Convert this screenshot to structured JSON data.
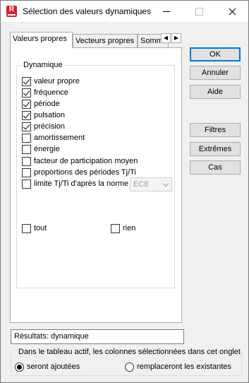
{
  "window": {
    "title": "Sélection des valeurs dynamiques",
    "app_icon_letter": "R"
  },
  "tabs": [
    {
      "label": "Valeurs propres",
      "active": true
    },
    {
      "label": "Vecteurs propres",
      "active": false
    },
    {
      "label": "Somm",
      "active": false
    }
  ],
  "group": {
    "legend": "Dynamique",
    "items": [
      {
        "label": "valeur propre",
        "checked": true
      },
      {
        "label": "fréquence",
        "checked": true
      },
      {
        "label": "période",
        "checked": true
      },
      {
        "label": "pulsation",
        "checked": true
      },
      {
        "label": "précision",
        "checked": true
      },
      {
        "label": "amortissement",
        "checked": false
      },
      {
        "label": "énergie",
        "checked": false
      },
      {
        "label": "facteur de participation moyen",
        "checked": false
      },
      {
        "label": "proportions des périodes Tj/Ti",
        "checked": false
      },
      {
        "label": "limite Tj/Ti d'après la norme",
        "checked": false
      }
    ],
    "norm_select": {
      "value": "EC8"
    },
    "all_label": "tout",
    "none_label": "rien"
  },
  "buttons": {
    "ok": "OK",
    "cancel": "Annuler",
    "help": "Aide",
    "filters": "Filtres",
    "extremes": "Extrêmes",
    "cases": "Cas"
  },
  "result": "Résultats: dynamique",
  "bottom": {
    "legend": "Dans le tableau actif, les colonnes sélectionnées dans cet onglet",
    "options": [
      {
        "label": "seront ajoutées",
        "checked": true
      },
      {
        "label": "remplaceront les existantes",
        "checked": false
      }
    ]
  }
}
